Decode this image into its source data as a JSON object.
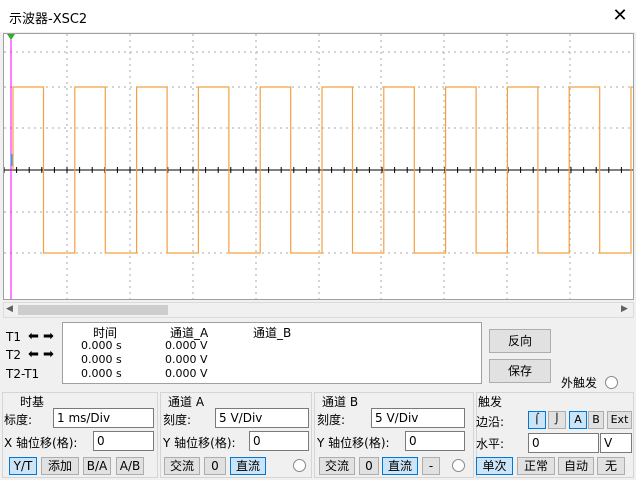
{
  "window": {
    "title": "示波器-XSC2",
    "close_glyph": "✕"
  },
  "cursors": {
    "t1_label": "T1",
    "t2_label": "T2",
    "diff_label": "T2-T1",
    "headers": {
      "time": "时间",
      "channel_a": "通道_A",
      "channel_b": "通道_B"
    },
    "rows": [
      {
        "time": "0.000 s",
        "a": "0.000 V"
      },
      {
        "time": "0.000 s",
        "a": "0.000 V"
      },
      {
        "time": "0.000 s",
        "a": "0.000 V"
      }
    ]
  },
  "side_buttons": {
    "reverse": "反向",
    "save": "保存"
  },
  "ext_trigger_label": "外触发",
  "timebase": {
    "title": "时基",
    "scale_label": "标度:",
    "scale_value": "1 ms/Div",
    "xpos_label": "X 轴位移(格):",
    "xpos_value": "0",
    "modes": [
      "Y/T",
      "添加",
      "B/A",
      "A/B"
    ]
  },
  "channel_a": {
    "title": "通道 A",
    "scale_label": "刻度:",
    "scale_value": "5  V/Div",
    "ypos_label": "Y 轴位移(格):",
    "ypos_value": "0",
    "coupling": [
      "交流",
      "0",
      "直流"
    ]
  },
  "channel_b": {
    "title": "通道 B",
    "scale_label": "刻度:",
    "scale_value": "5  V/Div",
    "ypos_label": "Y 轴位移(格):",
    "ypos_value": "0",
    "coupling": [
      "交流",
      "0",
      "直流",
      "-"
    ]
  },
  "trigger": {
    "title": "触发",
    "edge_label": "边沿:",
    "level_label": "水平:",
    "level_value": "0",
    "level_unit": "V",
    "edge_buttons": [
      "A",
      "B",
      "Ext"
    ],
    "modes": [
      "单次",
      "正常",
      "自动",
      "无"
    ]
  },
  "colors": {
    "trace": "#f5a040",
    "grid": "#a8a8a8",
    "axis": "#000000",
    "t1_cursor": "#ff00ff",
    "t2_cursor": "#00b4ff"
  }
}
